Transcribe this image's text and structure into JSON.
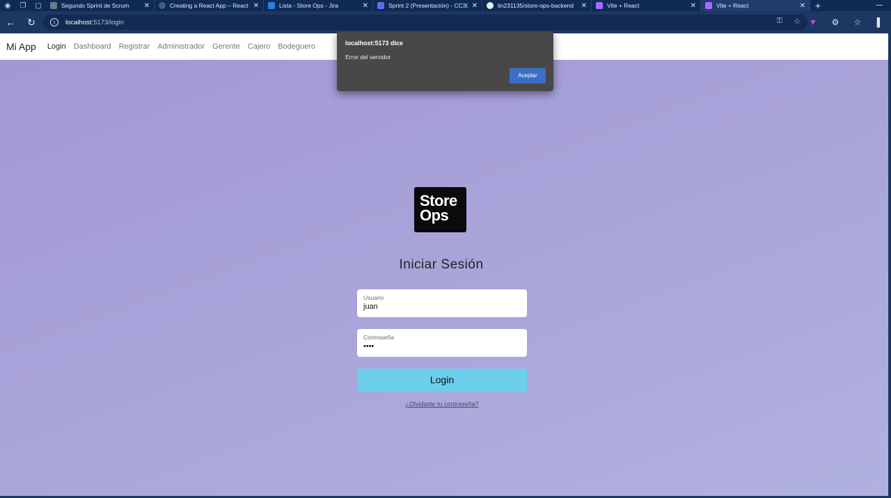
{
  "browser": {
    "tabs": [
      {
        "label": "Segundo Sprint de Scrum",
        "icon": "document-icon",
        "color": "#6c7a8c"
      },
      {
        "label": "Creating a React App – React",
        "icon": "react-icon",
        "color": "#3a5f8a"
      },
      {
        "label": "Lista - Store Ops - Jira",
        "icon": "jira-icon",
        "color": "#2d7be6"
      },
      {
        "label": "Sprint 2 (Presentación) - CC30",
        "icon": "slides-icon",
        "color": "#5b6cf0"
      },
      {
        "label": "lin231135/store-ops-backend",
        "icon": "github-icon",
        "color": "#e7ecf4"
      },
      {
        "label": "Vite + React",
        "icon": "vite-icon",
        "color": "#a56bff"
      },
      {
        "label": "Vite + React",
        "icon": "vite-icon",
        "color": "#a56bff",
        "active": true
      }
    ],
    "url_host": "localhost",
    "url_path": ":5173/login"
  },
  "app": {
    "brand": "Mi App",
    "nav": [
      "Login",
      "Dashboard",
      "Registrar",
      "Administrador",
      "Gerente",
      "Cajero",
      "Bodeguero"
    ],
    "logo_line1": "Store",
    "logo_line2": "Ops",
    "title": "Iniciar Sesión",
    "username_label": "Usuario",
    "username_value": "juan",
    "password_label": "Contraseña",
    "password_value": "••••",
    "login_button": "Login",
    "forgot_link": "¿Olvidaste tu contraseña?"
  },
  "alert": {
    "title": "localhost:5173 dice",
    "message": "Error del servidor",
    "button": "Aceptar"
  }
}
